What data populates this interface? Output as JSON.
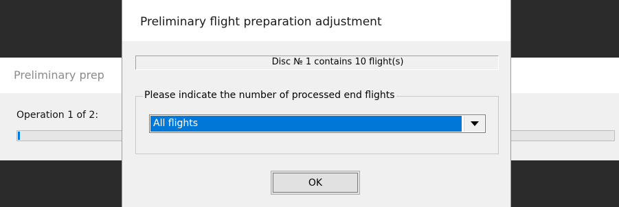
{
  "background_window": {
    "title": "Preliminary prep",
    "operation_label": "Operation 1 of 2:",
    "progress_fraction": 0.003
  },
  "dialog": {
    "title": "Preliminary flight preparation adjustment",
    "info_text": "Disc № 1 contains 10 flight(s)",
    "group_label": "Please indicate the number of processed end flights",
    "select_value": "All flights",
    "ok_label": "OK"
  },
  "colors": {
    "selection": "#0078d7",
    "dark_backdrop": "#2b2b2b"
  }
}
